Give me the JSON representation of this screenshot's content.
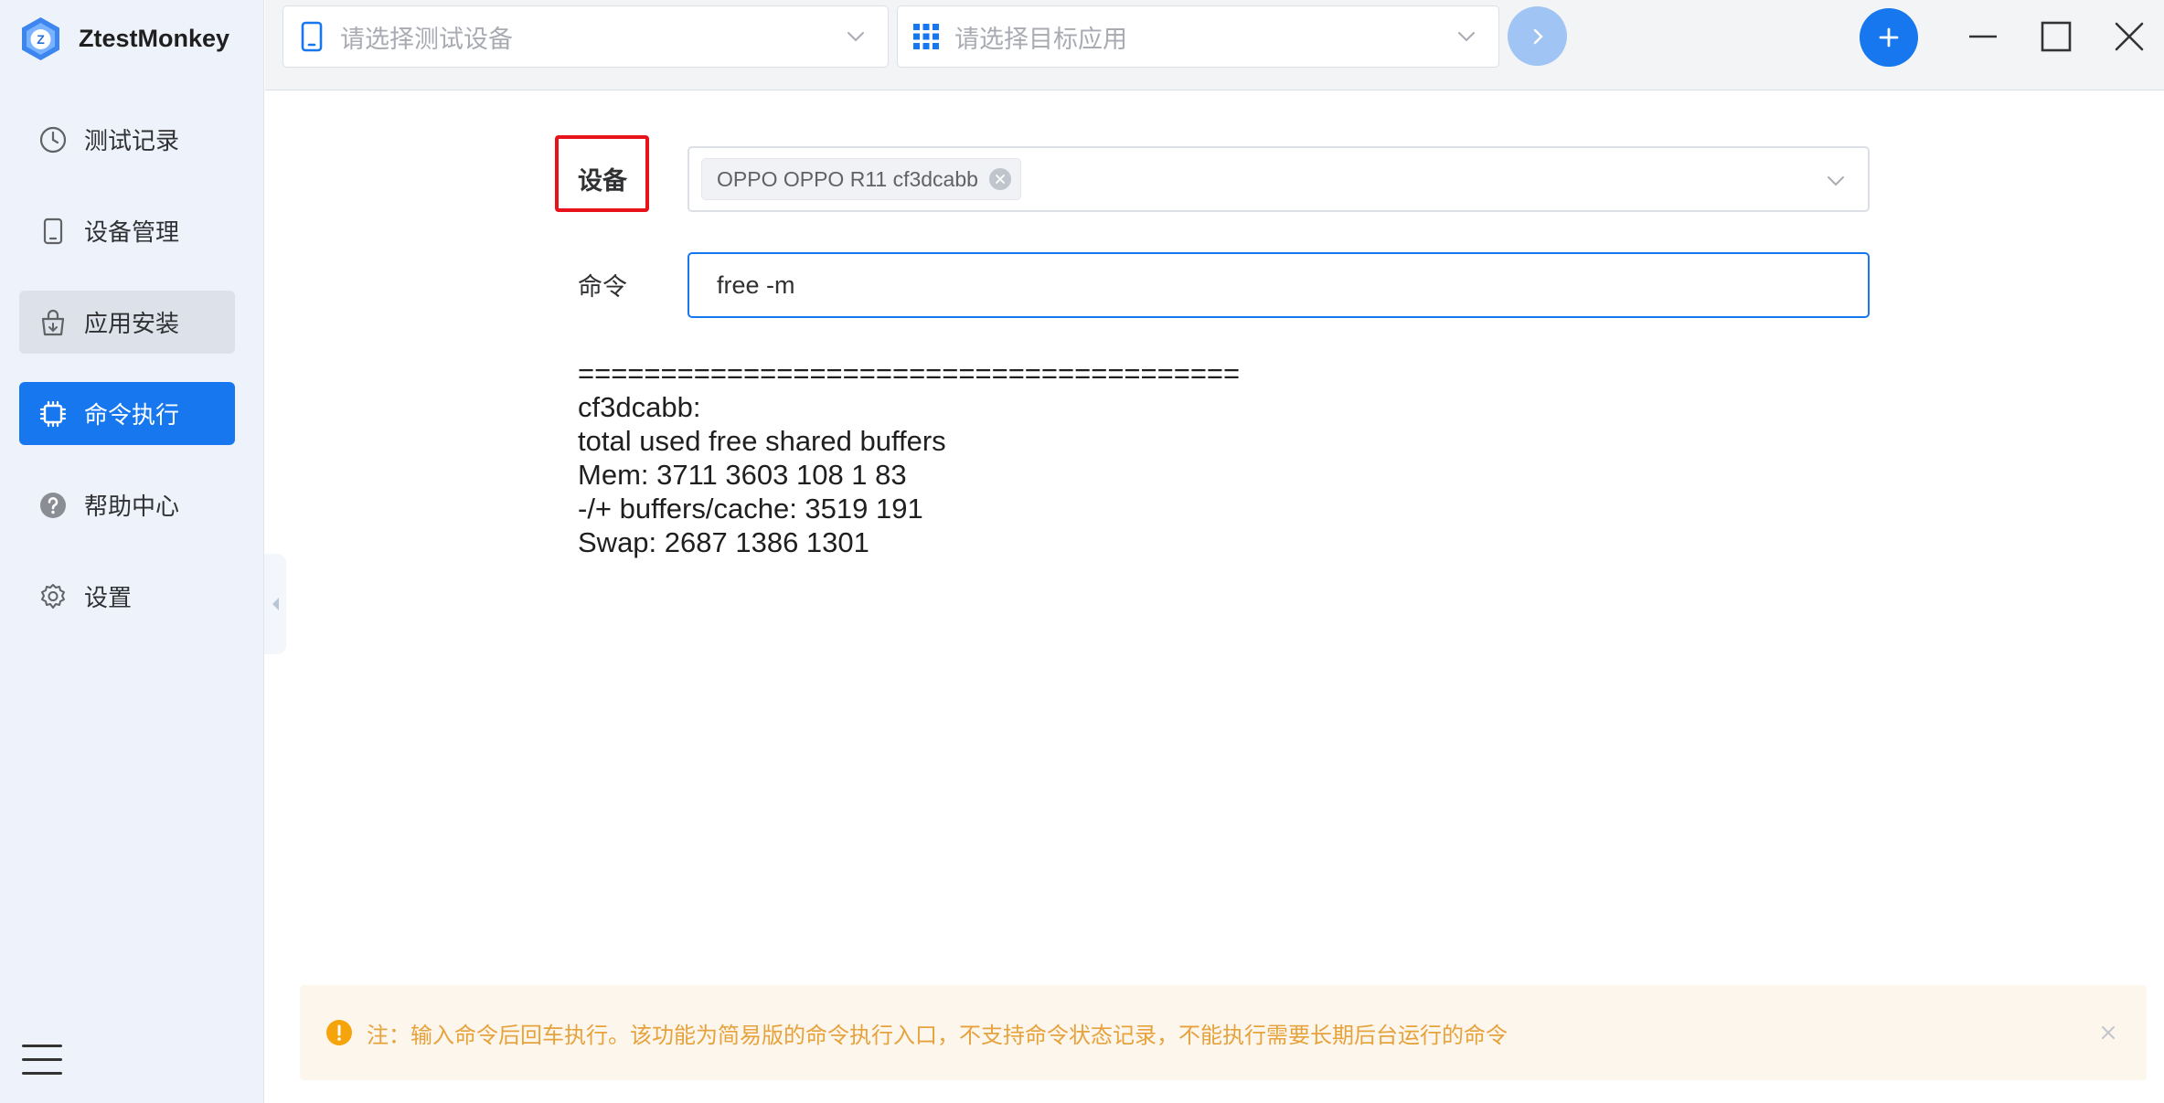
{
  "app": {
    "title": "ZtestMonkey",
    "logo_letter": "Z"
  },
  "sidebar": {
    "items": [
      {
        "label": "测试记录",
        "icon": "clock-icon"
      },
      {
        "label": "设备管理",
        "icon": "tablet-icon"
      },
      {
        "label": "应用安装",
        "icon": "bag-icon"
      },
      {
        "label": "命令执行",
        "icon": "chip-icon"
      },
      {
        "label": "帮助中心",
        "icon": "help-icon"
      },
      {
        "label": "设置",
        "icon": "gear-icon"
      }
    ],
    "active_index": 3
  },
  "topbar": {
    "device_placeholder": "请选择测试设备",
    "app_placeholder": "请选择目标应用"
  },
  "form": {
    "device_label": "设备",
    "device_tag": "OPPO OPPO R11 cf3dcabb",
    "command_label": "命令",
    "command_value": "free -m"
  },
  "output": {
    "lines": [
      "========================================",
      "cf3dcabb:",
      "total used free shared buffers",
      "Mem: 3711 3603 108 1 83",
      "-/+ buffers/cache: 3519 191",
      "Swap: 2687 1386 1301"
    ]
  },
  "notice": {
    "text": "注：输入命令后回车执行。该功能为简易版的命令执行入口，不支持命令状态记录，不能执行需要长期后台运行的命令"
  },
  "colors": {
    "primary": "#1677ee",
    "highlight": "#e8121a",
    "warning": "#e6a23c"
  }
}
